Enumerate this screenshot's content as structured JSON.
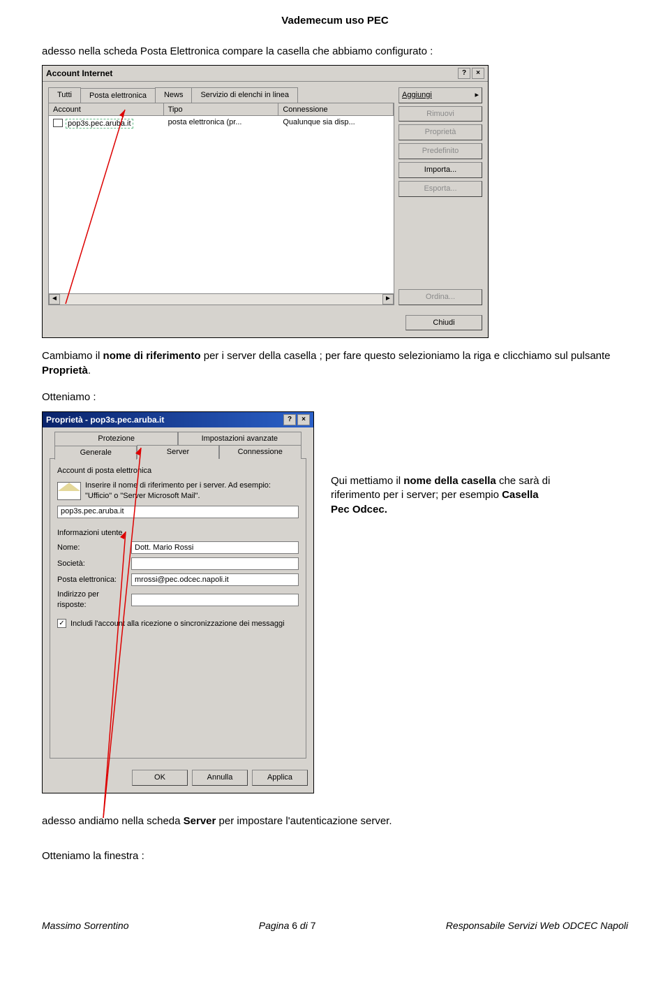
{
  "doc_title": "Vademecum uso PEC",
  "intro_text": "adesso nella scheda Posta Elettronica compare la casella che abbiamo configurato :",
  "dlg1": {
    "title": "Account Internet",
    "help": "?",
    "close": "×",
    "tabs": {
      "tutti": "Tutti",
      "posta": "Posta elettronica",
      "news": "News",
      "servizio": "Servizio di elenchi in linea"
    },
    "headers": {
      "account": "Account",
      "tipo": "Tipo",
      "conn": "Connessione"
    },
    "row": {
      "account": "pop3s.pec.aruba.it",
      "tipo": "posta elettronica (pr...",
      "conn": "Qualunque sia disp..."
    },
    "buttons": {
      "aggiungi": "Aggiungi",
      "rimuovi": "Rimuovi",
      "proprieta": "Proprietà",
      "predefinito": "Predefinito",
      "importa": "Importa...",
      "esporta": "Esporta...",
      "ordina": "Ordina...",
      "chiudi": "Chiudi"
    }
  },
  "para2_a": "Cambiamo  il ",
  "para2_b": "nome di riferimento",
  "para2_c": " per i server della  casella ; per fare questo selezioniamo la riga e clicchiamo  sul pulsante ",
  "para2_d": "Proprietà",
  "para2_e": ".",
  "otteniamo": "Otteniamo :",
  "dlg2": {
    "title": "Proprietà - pop3s.pec.aruba.it",
    "tabs_top": {
      "protezione": "Protezione",
      "avanzate": "Impostazioni avanzate"
    },
    "tabs_bot": {
      "generale": "Generale",
      "server": "Server",
      "connessione": "Connessione"
    },
    "section_account": "Account di posta elettronica",
    "account_help": "Inserire il nome di riferimento per i server. Ad esempio:\n\"Ufficio\" o \"Server Microsoft Mail\".",
    "account_field": "pop3s.pec.aruba.it",
    "section_user": "Informazioni utente",
    "labels": {
      "nome": "Nome:",
      "societa": "Società:",
      "posta": "Posta elettronica:",
      "risposte": "Indirizzo per risposte:"
    },
    "values": {
      "nome": "Dott. Mario Rossi",
      "societa": "",
      "posta": "mrossi@pec.odcec.napoli.it",
      "risposte": ""
    },
    "check": "Includi l'account alla ricezione o sincronizzazione dei messaggi",
    "footer": {
      "ok": "OK",
      "annulla": "Annulla",
      "applica": "Applica"
    }
  },
  "side_a": "Qui mettiamo il ",
  "side_b": "nome della casella",
  "side_c": " che sarà di riferimento per i server; per esempio ",
  "side_d": "Casella Pec Odcec.",
  "para3_a": "adesso andiamo nella scheda ",
  "para3_b": "Server",
  "para3_c": " per impostare  l'autenticazione server.",
  "otteniamo2": "Otteniamo la finestra :",
  "footer": {
    "left": "Massimo Sorrentino",
    "mid_a": "Pagina ",
    "mid_b": "6",
    "mid_c": " di ",
    "mid_d": "7",
    "right": "Responsabile Servizi Web ODCEC Napoli"
  }
}
